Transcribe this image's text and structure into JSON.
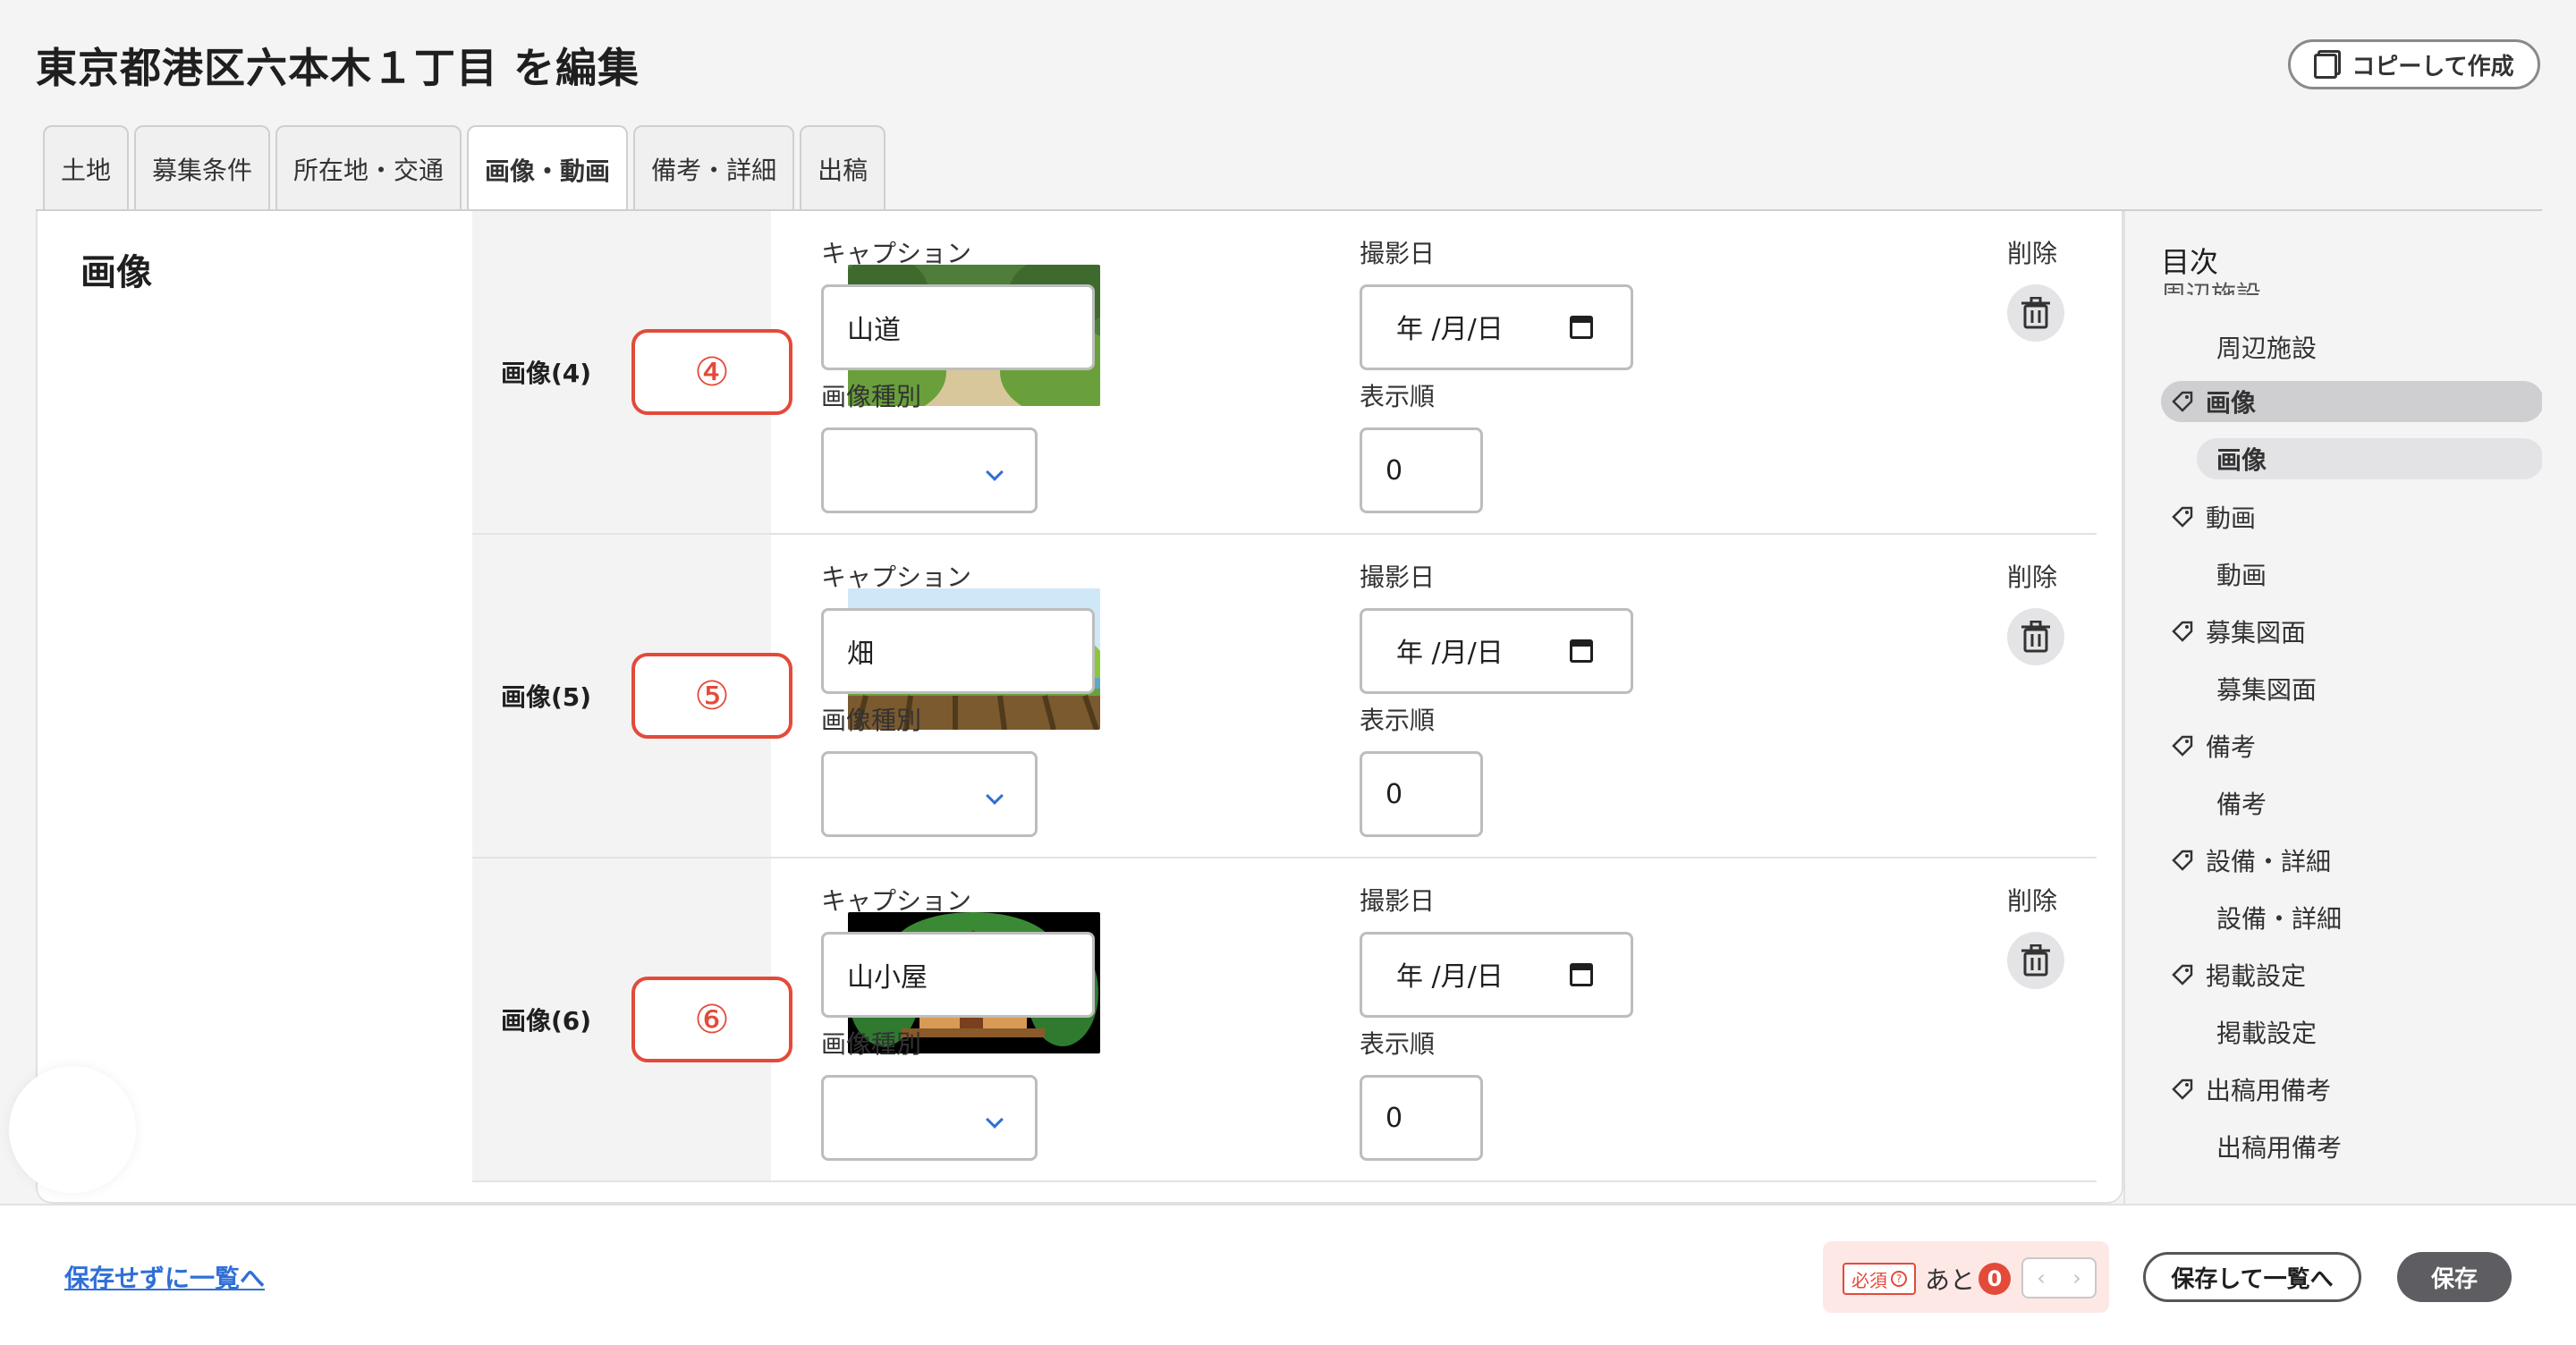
{
  "page": {
    "title": "東京都港区六本木１丁目 を編集",
    "copy_button": "コピーして作成"
  },
  "tabs": [
    {
      "label": "土地"
    },
    {
      "label": "募集条件"
    },
    {
      "label": "所在地・交通"
    },
    {
      "label": "画像・動画"
    },
    {
      "label": "備考・詳細"
    },
    {
      "label": "出稿"
    }
  ],
  "section": {
    "title": "画像"
  },
  "field_labels": {
    "caption": "キャプション",
    "shoot_date": "撮影日",
    "delete": "削除",
    "image_type": "画像種別",
    "display_order": "表示順"
  },
  "rows": [
    {
      "label": "画像(4)",
      "badge": "④",
      "caption": "山道",
      "date": "年 /月/日",
      "order": "0"
    },
    {
      "label": "画像(5)",
      "badge": "⑤",
      "caption": "畑",
      "date": "年 /月/日",
      "order": "0"
    },
    {
      "label": "画像(6)",
      "badge": "⑥",
      "caption": "山小屋",
      "date": "年 /月/日",
      "order": "0"
    }
  ],
  "toc": {
    "title": "目次",
    "cut_item": "周辺施設",
    "items": [
      {
        "label": "周辺施設"
      },
      {
        "label": "画像"
      },
      {
        "label": "画像"
      },
      {
        "label": "動画"
      },
      {
        "label": "動画"
      },
      {
        "label": "募集図面"
      },
      {
        "label": "募集図面"
      },
      {
        "label": "備考"
      },
      {
        "label": "備考"
      },
      {
        "label": "設備・詳細"
      },
      {
        "label": "設備・詳細"
      },
      {
        "label": "掲載設定"
      },
      {
        "label": "掲載設定"
      },
      {
        "label": "出稿用備考"
      },
      {
        "label": "出稿用備考"
      }
    ]
  },
  "footer": {
    "back_link": "保存せずに一覧へ",
    "required_badge": "必須",
    "required_help": "?",
    "remaining_text": "あと",
    "remaining_count": "0",
    "pager_prev": "‹",
    "pager_next": "›",
    "save_and_list": "保存して一覧へ",
    "save": "保存"
  },
  "colors": {
    "accent": "#e34a3a",
    "link": "#2f6fd6",
    "primary_button": "#5d5d62"
  }
}
